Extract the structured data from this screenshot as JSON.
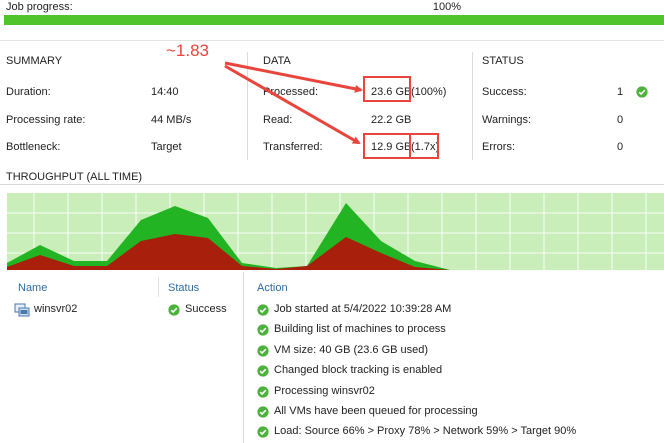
{
  "job_progress": {
    "label": "Job progress:",
    "percent_text": "100%",
    "value": 1.0
  },
  "summary": {
    "heading": "SUMMARY",
    "rows": [
      {
        "label": "Duration:",
        "value": "14:40"
      },
      {
        "label": "Processing rate:",
        "value": "44 MB/s"
      },
      {
        "label": "Bottleneck:",
        "value": "Target"
      }
    ]
  },
  "data": {
    "heading": "DATA",
    "rows": [
      {
        "label": "Processed:",
        "value": "23.6 GB",
        "extra": "(100%)"
      },
      {
        "label": "Read:",
        "value": "22.2 GB",
        "extra": ""
      },
      {
        "label": "Transferred:",
        "value": "12.9 GB",
        "extra": "(1.7x)"
      }
    ]
  },
  "status": {
    "heading": "STATUS",
    "rows": [
      {
        "label": "Success:",
        "value": "1"
      },
      {
        "label": "Warnings:",
        "value": "0"
      },
      {
        "label": "Errors:",
        "value": "0"
      }
    ]
  },
  "annotation": {
    "text": "~1.83",
    "color": "#e8453c"
  },
  "throughput": {
    "title": "THROUGHPUT (ALL TIME)",
    "colors": {
      "background": "#c9eeb9",
      "grid": "#ffffff",
      "read": "#22b422",
      "transfer": "#a81f0c"
    }
  },
  "vm_list": {
    "columns": [
      "Name",
      "Status"
    ],
    "rows": [
      {
        "name": "winsvr02",
        "status": "Success",
        "icon": "vm-icon",
        "status_icon": "check-icon"
      }
    ]
  },
  "action_log": {
    "column": "Action",
    "entries": [
      "Job started at 5/4/2022 10:39:28 AM",
      "Building list of machines to process",
      "VM size: 40 GB (23.6 GB used)",
      "Changed block tracking is enabled",
      "Processing winsvr02",
      "All VMs have been queued for processing",
      "Load: Source 66% > Proxy 78% > Network 59% > Target 90%"
    ]
  }
}
